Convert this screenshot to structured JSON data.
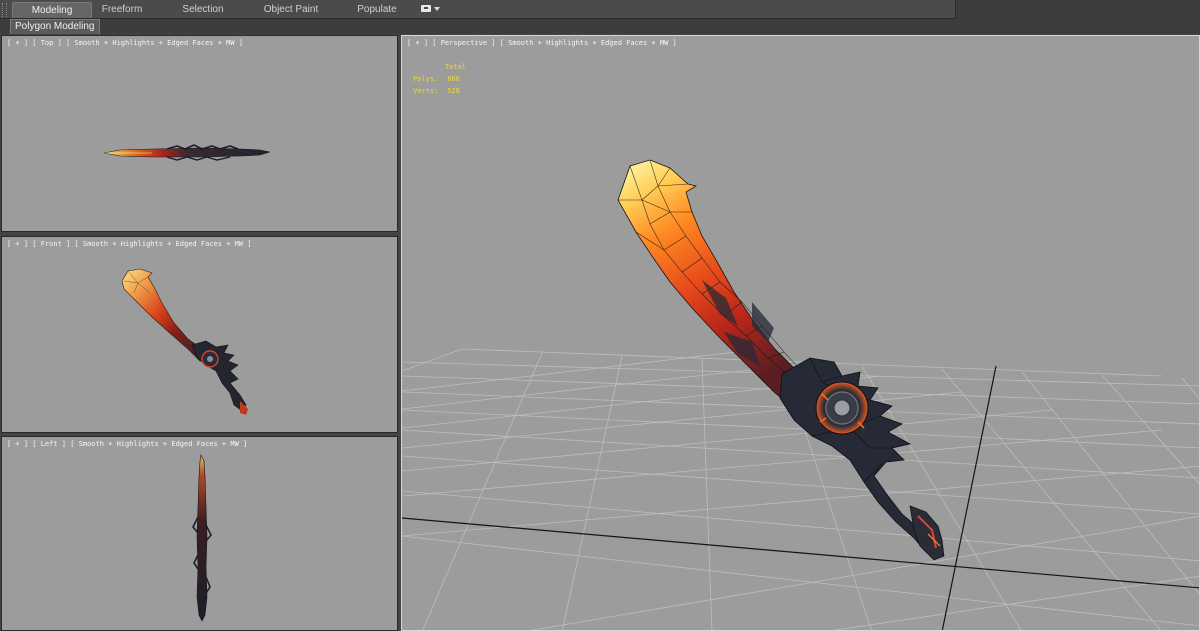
{
  "ribbon": {
    "tabs": [
      {
        "label": "Modeling"
      },
      {
        "label": "Freeform"
      },
      {
        "label": "Selection"
      },
      {
        "label": "Object Paint"
      },
      {
        "label": "Populate"
      }
    ],
    "subtab": "Polygon Modeling"
  },
  "viewports": {
    "top": {
      "label": "[ + ] [ Top ] [ Smooth + Highlights + Edged Faces + MW ]"
    },
    "front": {
      "label": "[ + ] [ Front ] [ Smooth + Highlights + Edged Faces + MW ]"
    },
    "left": {
      "label": "[ + ] [ Left ] [ Smooth + Highlights + Edged Faces + MW ]"
    },
    "perspective": {
      "label": "[ + ] [ Perspective ] [ Smooth + Highlights + Edged Faces + MW ]",
      "stats": {
        "header": "Total",
        "polys_label": "Polys:",
        "polys_value": "860",
        "verts_label": "Verts:",
        "verts_value": "528"
      }
    }
  },
  "colors": {
    "viewport_bg": "#9c9c9c",
    "grid_line": "#bdbdbd",
    "stats_text": "#e8d84a",
    "blade_hot": "#ff7a1a",
    "blade_tip": "#ffd96a",
    "hilt_dark": "#2a2d3c"
  },
  "icons": [
    "ribbon-grip-icon",
    "view-dropdown-icon"
  ]
}
